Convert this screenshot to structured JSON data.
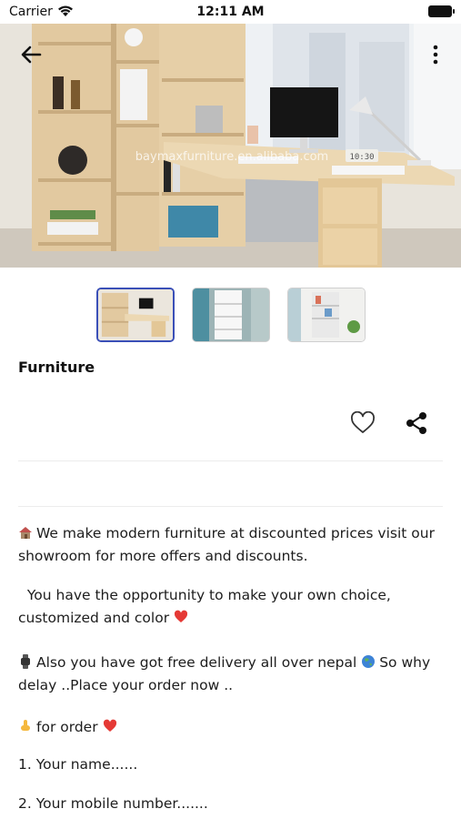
{
  "status_bar": {
    "carrier": "Carrier",
    "time": "12:11 AM"
  },
  "hero": {
    "watermark": "baymaxfurniture.en.alibaba.com",
    "clock_display": "10:30"
  },
  "product": {
    "title": "Furniture"
  },
  "icons": {
    "back": "arrow-left-icon",
    "more": "more-vertical-icon",
    "favorite": "heart-outline-icon",
    "share": "share-icon"
  },
  "description": {
    "p1": "We make modern furniture at discounted prices visit our showroom for more offers and discounts.",
    "p2": "You have the opportunity to make your own choice, customized and color",
    "p3a": "Also you have got free delivery all over nepal",
    "p3b": "So why delay ..Place your order now ..",
    "p4": "for order",
    "p5": "1. Your name......",
    "p6": "2. Your mobile number......."
  }
}
